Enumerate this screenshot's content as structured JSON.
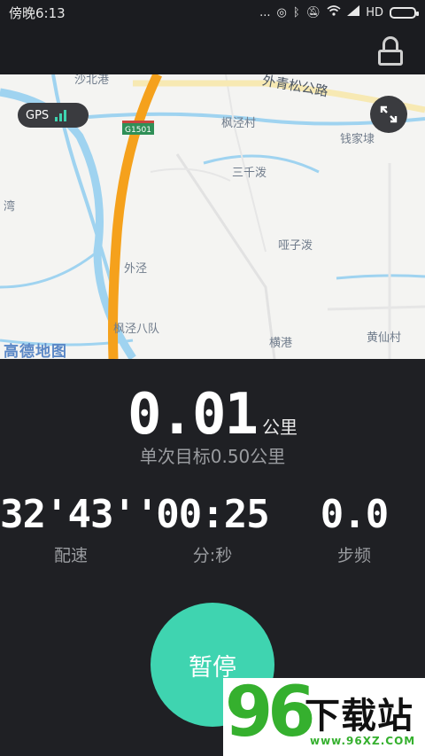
{
  "status_bar": {
    "time": "傍晚6:13",
    "dots": "...",
    "signal_label": "HD"
  },
  "map": {
    "gps_label": "GPS",
    "route_badge": "G1501",
    "logo_text": "高德地图",
    "labels": [
      "沙北港",
      "外青松公路",
      "枫泾村",
      "钱家埭",
      "三千泼",
      "湾",
      "哑子泼",
      "外泾",
      "枫泾八队",
      "横港",
      "黄仙村"
    ]
  },
  "workout": {
    "distance_value": "0.01",
    "distance_unit": "公里",
    "goal_text": "单次目标0.50公里",
    "stats": [
      {
        "value": "32'43''",
        "label": "配速"
      },
      {
        "value": "00:25",
        "label": "分:秒"
      },
      {
        "value": "0.0",
        "label": "步频"
      }
    ],
    "pause_label": "暂停"
  },
  "watermark": {
    "number": "96",
    "text": "下载站",
    "url": "www.96XZ.COM"
  },
  "colors": {
    "accent": "#3fd4b0",
    "background": "#1f2024",
    "route": "#f5a11c"
  }
}
